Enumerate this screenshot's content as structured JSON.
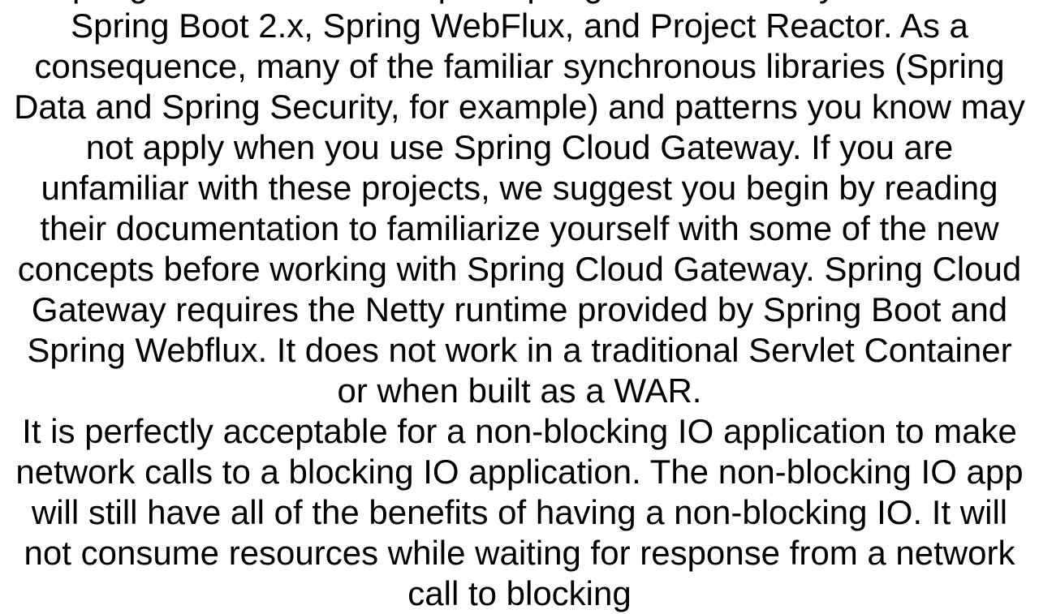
{
  "content": {
    "paragraph1": "Spring Cloud is built on top of Spring Boot. Gateway is built on Spring Boot 2.x, Spring WebFlux, and Project Reactor. As a consequence, many of the familiar synchronous libraries (Spring Data and Spring Security, for example) and patterns you know may not apply when you use Spring Cloud Gateway. If you are unfamiliar with these projects, we suggest you begin by reading their documentation to familiarize yourself with some of the new concepts before working with Spring Cloud Gateway.   Spring Cloud Gateway requires the Netty runtime provided by Spring Boot and Spring Webflux. It does not work in a traditional Servlet Container or when built as a WAR.",
    "paragraph2": "It is perfectly acceptable for a non-blocking IO application to make network calls to a blocking IO application. The non-blocking IO app will still have all of the benefits of having a non-blocking IO. It will not consume resources while waiting for response from a network call to blocking"
  }
}
